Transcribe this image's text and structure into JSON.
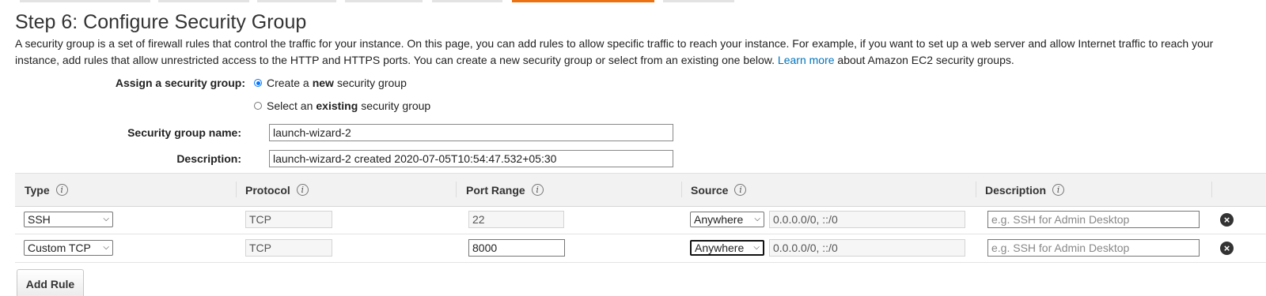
{
  "page": {
    "title": "Step 6: Configure Security Group",
    "intro_text": "A security group is a set of firewall rules that control the traffic for your instance. On this page, you can add rules to allow specific traffic to reach your instance. For example, if you want to set up a web server and allow Internet traffic to reach your instance, add rules that allow unrestricted access to the HTTP and HTTPS ports. You can create a new security group or select from an existing one below.",
    "learn_more": "Learn more",
    "intro_suffix": "about Amazon EC2 security groups."
  },
  "assign": {
    "label": "Assign a security group:",
    "option_create": {
      "prefix": "Create a",
      "bold": "new",
      "suffix": "security group",
      "selected": true
    },
    "option_existing": {
      "prefix": "Select an",
      "bold": "existing",
      "suffix": "security group",
      "selected": false
    }
  },
  "group_name": {
    "label": "Security group name:",
    "value": "launch-wizard-2"
  },
  "group_description": {
    "label": "Description:",
    "value": "launch-wizard-2 created 2020-07-05T10:54:47.532+05:30"
  },
  "table": {
    "headers": [
      "Type",
      "Protocol",
      "Port Range",
      "Source",
      "Description"
    ],
    "rows": [
      {
        "type": "SSH",
        "protocol": "TCP",
        "port": "22",
        "source": "Anywhere",
        "cidr": "0.0.0.0/0, ::/0",
        "description_placeholder": "e.g. SSH for Admin Desktop"
      },
      {
        "type": "Custom TCP",
        "protocol": "TCP",
        "port": "8000",
        "source": "Anywhere",
        "cidr": "0.0.0.0/0, ::/0",
        "description_placeholder": "e.g. SSH for Admin Desktop"
      }
    ]
  },
  "buttons": {
    "add_rule": "Add Rule"
  },
  "icons": {
    "info": "i",
    "remove": "×"
  },
  "colors": {
    "accent": "#ec7211",
    "link": "#0073bb",
    "radio": "#0075ff"
  }
}
